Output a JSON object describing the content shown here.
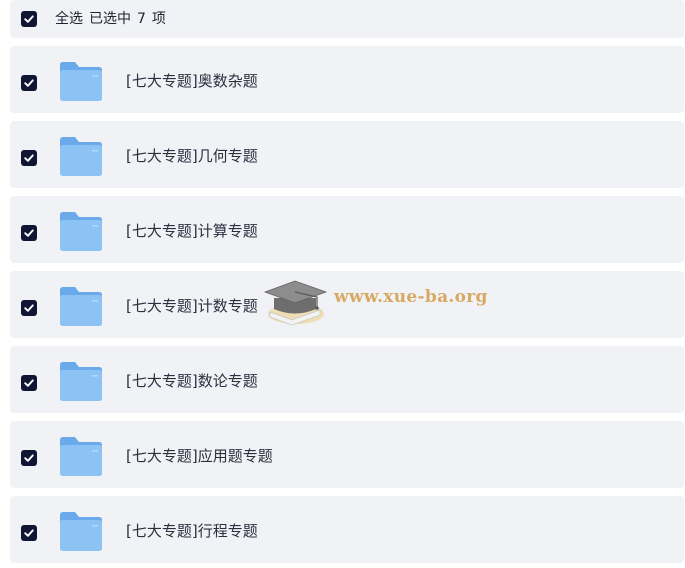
{
  "header": {
    "select_all": "全选",
    "selected_prefix": "已选中",
    "selected_count": "7",
    "selected_suffix": "项",
    "checked": true
  },
  "items": [
    {
      "name": "[七大专题]奥数杂题",
      "checked": true,
      "icon": "folder-icon"
    },
    {
      "name": "[七大专题]几何专题",
      "checked": true,
      "icon": "folder-icon"
    },
    {
      "name": "[七大专题]计算专题",
      "checked": true,
      "icon": "folder-icon"
    },
    {
      "name": "[七大专题]计数专题",
      "checked": true,
      "icon": "folder-icon"
    },
    {
      "name": "[七大专题]数论专题",
      "checked": true,
      "icon": "folder-icon"
    },
    {
      "name": "[七大专题]应用题专题",
      "checked": true,
      "icon": "folder-icon"
    },
    {
      "name": "[七大专题]行程专题",
      "checked": true,
      "icon": "folder-icon"
    }
  ],
  "watermark": {
    "text": "www.xue-ba.org",
    "icon": "graduation-cap-icon"
  },
  "colors": {
    "row_bg": "#f1f2f5",
    "checkbox": "#101533",
    "folder": "#7db8f0",
    "watermark": "#d8a964"
  }
}
